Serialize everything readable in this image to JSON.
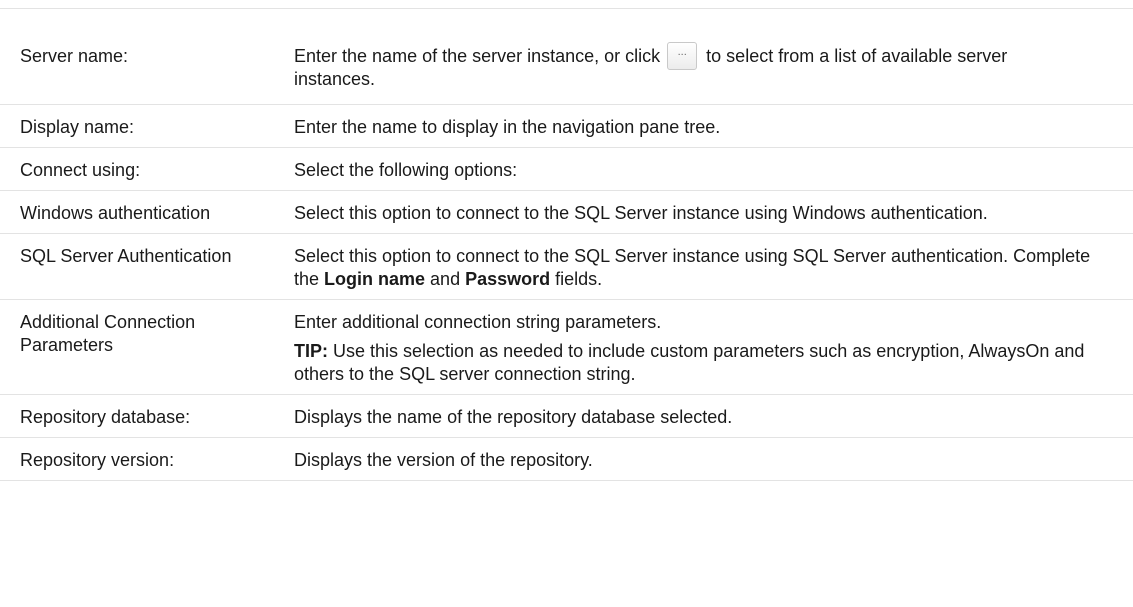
{
  "rows": [
    {
      "label": "Server name:",
      "text_before_button": "Enter the name of the server instance, or click ",
      "button_label": "...",
      "text_after_button": " to select from a list of available server instances."
    },
    {
      "label": "Display name:",
      "text": "Enter the name to display in the navigation pane tree."
    },
    {
      "label": "Connect using:",
      "text": "Select the following options:"
    },
    {
      "label": "Windows authentication",
      "text": "Select this option to connect to the SQL Server instance using Windows authentication."
    },
    {
      "label": "SQL Server Authentication",
      "text_before": "Select this option to connect to the SQL Server instance using SQL Server authentication. Complete the ",
      "login_name": "Login name",
      "and": " and ",
      "password": "Password",
      "text_after": " fields."
    },
    {
      "label": "Additional Connection Parameters",
      "text": "Enter additional connection string parameters.",
      "tip_label": "TIP:",
      "tip_text": " Use this selection as needed to include custom parameters such as encryption, AlwaysOn and others to the SQL server connection string."
    },
    {
      "label": "Repository database:",
      "text": "Displays the name of the repository database selected."
    },
    {
      "label": "Repository version:",
      "text": "Displays the version of the repository."
    }
  ]
}
